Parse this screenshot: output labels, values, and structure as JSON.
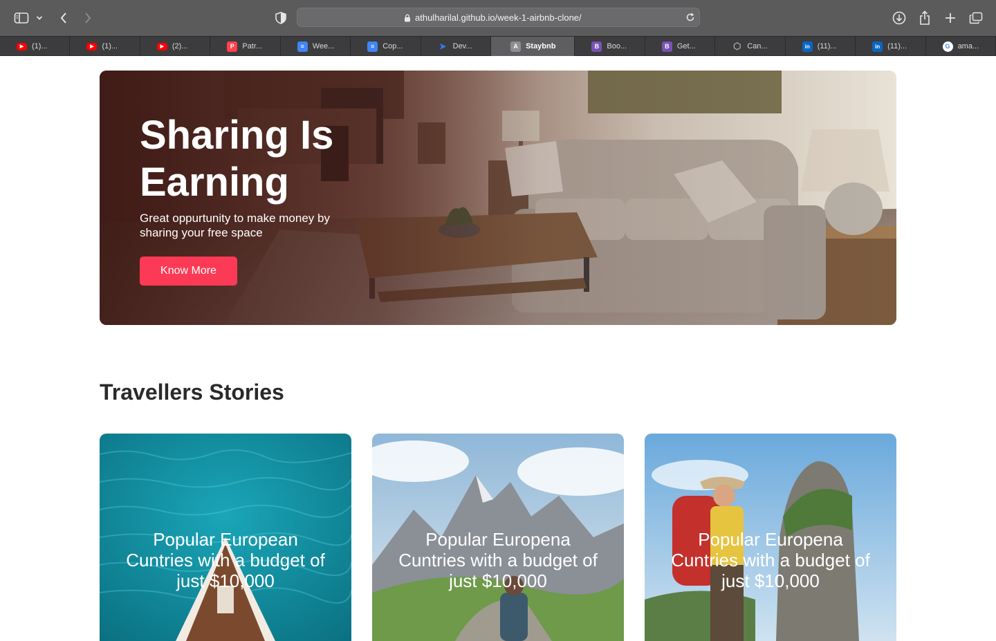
{
  "browser": {
    "url": "athulharilal.github.io/week-1-airbnb-clone/",
    "tabs": [
      {
        "label": "(1)...",
        "favicon": "youtube-icon",
        "color": "#ff0000"
      },
      {
        "label": "(1)...",
        "favicon": "youtube-icon",
        "color": "#ff0000"
      },
      {
        "label": "(2)...",
        "favicon": "youtube-icon",
        "color": "#ff0000"
      },
      {
        "label": "Patr...",
        "favicon": "patreon-icon",
        "color": "#ff424d"
      },
      {
        "label": "Wee...",
        "favicon": "google-docs-icon",
        "color": "#4285f4"
      },
      {
        "label": "Cop...",
        "favicon": "google-docs-icon",
        "color": "#4285f4"
      },
      {
        "label": "Dev...",
        "favicon": "dev-icon",
        "color": "#2d7ff9"
      },
      {
        "label": "Staybnb",
        "favicon": "letter-a-icon",
        "color": "#8e8e93",
        "active": true
      },
      {
        "label": "Boo...",
        "favicon": "bootstrap-icon",
        "color": "#7952b3"
      },
      {
        "label": "Get...",
        "favicon": "bootstrap-icon",
        "color": "#7952b3"
      },
      {
        "label": "Can...",
        "favicon": "cube-icon",
        "color": "#aaaaaa"
      },
      {
        "label": "(11)...",
        "favicon": "linkedin-icon",
        "color": "#0a66c2"
      },
      {
        "label": "(11)...",
        "favicon": "linkedin-icon",
        "color": "#0a66c2"
      },
      {
        "label": "ama...",
        "favicon": "google-icon",
        "color": "#ffffff"
      }
    ]
  },
  "hero": {
    "title": "Sharing Is Earning",
    "subtitle": "Great oppurtunity to make money by sharing your free space",
    "button_label": "Know More"
  },
  "stories": {
    "title": "Travellers Stories",
    "cards": [
      {
        "text": "Popular European Cuntries with a budget of just $10,000"
      },
      {
        "text": "Popular Europena Cuntries with a budget of just $10,000"
      },
      {
        "text": "Popular Europena Cuntries with a budget of just $10,000"
      }
    ]
  },
  "colors": {
    "accent": "#fd3a55",
    "toolbar": "#5b5b5c",
    "tabbar": "#3c3c3e"
  }
}
